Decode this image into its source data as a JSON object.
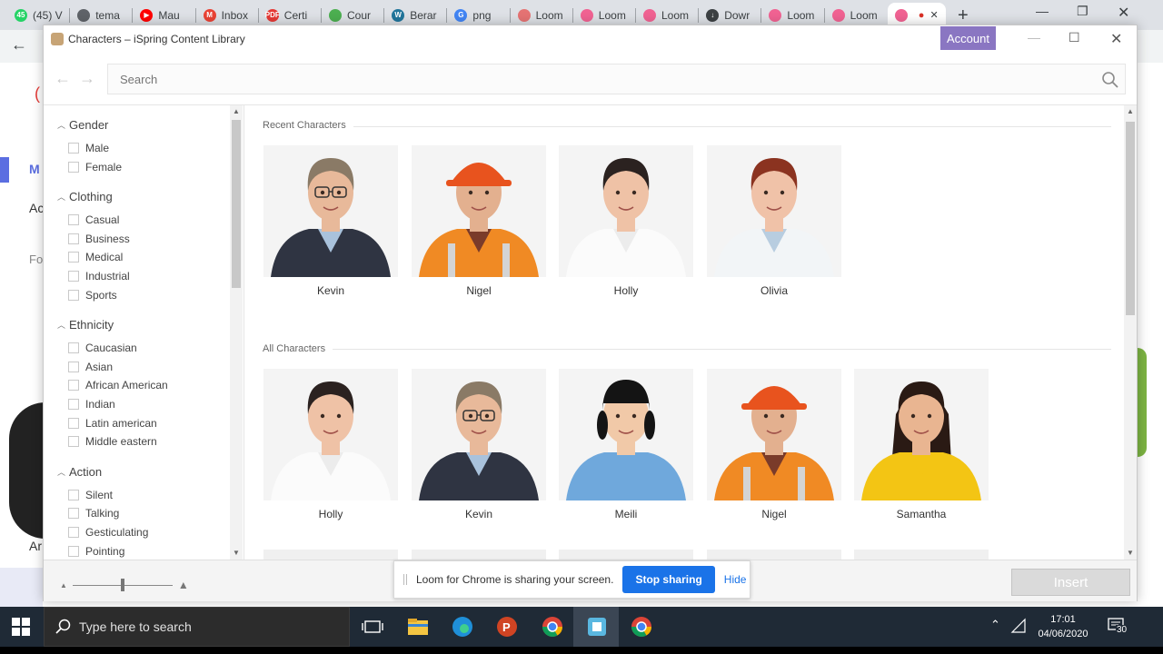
{
  "browser": {
    "tabs": [
      {
        "label": "(45) V",
        "favicon_color": "#25d366",
        "favicon_text": "45"
      },
      {
        "label": "tema",
        "favicon_color": "#5f6368",
        "favicon_text": ""
      },
      {
        "label": "Mau",
        "favicon_color": "#ff0000",
        "favicon_text": "▶"
      },
      {
        "label": "Inbox",
        "favicon_color": "#ea4335",
        "favicon_text": "M"
      },
      {
        "label": "Certi",
        "favicon_color": "#e53935",
        "favicon_text": "PDF"
      },
      {
        "label": "Cour",
        "favicon_color": "#4caf50",
        "favicon_text": ""
      },
      {
        "label": "Berar",
        "favicon_color": "#21759b",
        "favicon_text": "W"
      },
      {
        "label": "png",
        "favicon_color": "#4285f4",
        "favicon_text": "G"
      },
      {
        "label": "Loom",
        "favicon_color": "#e57373",
        "favicon_text": ""
      },
      {
        "label": "Loom",
        "favicon_color": "#f06292",
        "favicon_text": ""
      },
      {
        "label": "Loom",
        "favicon_color": "#f06292",
        "favicon_text": ""
      },
      {
        "label": "Dowr",
        "favicon_color": "#3c4043",
        "favicon_text": "↓"
      },
      {
        "label": "Loom",
        "favicon_color": "#f06292",
        "favicon_text": ""
      },
      {
        "label": "Loom",
        "favicon_color": "#f06292",
        "favicon_text": ""
      },
      {
        "label": "",
        "favicon_color": "#f06292",
        "favicon_text": ""
      }
    ]
  },
  "background_page": {
    "fragments": [
      "M",
      "Ac",
      "Fo",
      "Ar"
    ]
  },
  "dialog": {
    "title": "Characters – iSpring Content Library",
    "account_label": "Account",
    "search_placeholder": "Search",
    "sidebar": {
      "groups": [
        {
          "label": "Gender",
          "options": [
            "Male",
            "Female"
          ]
        },
        {
          "label": "Clothing",
          "options": [
            "Casual",
            "Business",
            "Medical",
            "Industrial",
            "Sports"
          ]
        },
        {
          "label": "Ethnicity",
          "options": [
            "Caucasian",
            "Asian",
            "African American",
            "Indian",
            "Latin american",
            "Middle eastern"
          ]
        },
        {
          "label": "Action",
          "options": [
            "Silent",
            "Talking",
            "Gesticulating",
            "Pointing"
          ]
        }
      ]
    },
    "recent": {
      "title": "Recent Characters",
      "characters": [
        {
          "name": "Kevin",
          "icon": "man-suit-glasses"
        },
        {
          "name": "Nigel",
          "icon": "worker-hardhat"
        },
        {
          "name": "Holly",
          "icon": "woman-white-shirt"
        },
        {
          "name": "Olivia",
          "icon": "woman-doctor-coat"
        }
      ]
    },
    "all": {
      "title": "All Characters",
      "characters": [
        {
          "name": "Holly",
          "icon": "woman-white-shirt"
        },
        {
          "name": "Kevin",
          "icon": "man-suit-glasses"
        },
        {
          "name": "Meili",
          "icon": "woman-nurse-scrubs"
        },
        {
          "name": "Nigel",
          "icon": "worker-hardhat"
        },
        {
          "name": "Samantha",
          "icon": "woman-yellow-polo"
        }
      ]
    },
    "insert_label": "Insert",
    "zoom_level": 0.5
  },
  "loom": {
    "message": "Loom for Chrome is sharing your screen.",
    "stop_label": "Stop sharing",
    "hide_label": "Hide"
  },
  "taskbar": {
    "search_label": "Type here to search",
    "time": "17:01",
    "date": "04/06/2020",
    "notification_count": "30"
  },
  "colors": {
    "account_bg": "#8a76c2",
    "stop_bg": "#1a73e8",
    "taskbar_bg": "#1f2a36"
  }
}
